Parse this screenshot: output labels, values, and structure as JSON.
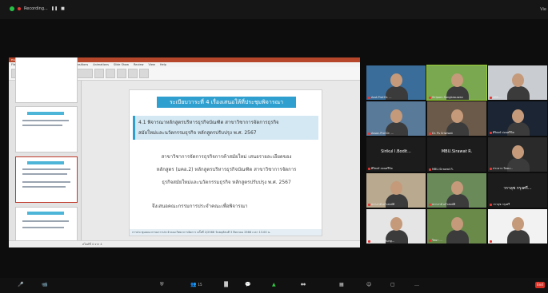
{
  "meeting": {
    "recording_label": "Recording...",
    "pause_glyph": "❚❚",
    "stop_glyph": "■",
    "view_label": "Vie"
  },
  "presentation": {
    "app_title": "PowerPoint",
    "tabs": [
      "File",
      "Home",
      "Insert",
      "Draw",
      "Design",
      "Transitions",
      "Animations",
      "Slide Show",
      "Review",
      "View",
      "Help"
    ],
    "slide": {
      "title": "ระเบียบวาระที่ 4 เรื่องเสนอให้ที่ประชุมพิจารณา",
      "subtitle_line1": "4.1 พิจารณาหลักสูตรบริหารธุรกิจบัณฑิต สาขาวิชาการจัดการธุรกิจ",
      "subtitle_line2": "สมัยใหม่และนวัตกรรมธุรกิจ หลักสูตรปรับปรุง พ.ศ. 2567",
      "body_line1": "สาขาวิชาการจัดการธุรกิจการค้าสมัยใหม่ เสนอรายละเอียดของ",
      "body_line2": "หลักสูตร (มคอ.2) หลักสูตรบริหารธุรกิจบัณฑิต สาขาวิชาการจัดการ",
      "body_line3": "ธุรกิจสมัยใหม่และนวัตกรรมธุรกิจ หลักสูตรปรับปรุง พ.ศ. 2567",
      "closing": "จึงเสนอคณะกรรมการประจำคณะเพื่อพิจารณา",
      "footer": "การประชุมคณะกรรมการประจำคณะวิทยาการจัดการ ครั้งที่ 2/2566 วันพฤหัสบดี 3 สิงหาคม 2566 เวลา 13.00 น."
    },
    "status_text": "สไลด์ที่ 4 จาก 4"
  },
  "participants": [
    {
      "name": "Asst.Prof.Dr. ...",
      "color": "#3a6d9a"
    },
    {
      "name": "Siriporn Sangkasuwan",
      "color": "#7aa850"
    },
    {
      "name": "ABS-...",
      "color": "#c9ccd1"
    },
    {
      "name": "Assoc.Prof.Dr. ...",
      "color": "#5a7a9a"
    },
    {
      "name": "Dr. Ps Sriwiwat",
      "color": "#6b5a4a"
    },
    {
      "name": "ศิริพงษ์ อ่อนศรีนิล",
      "color": "#1b2533"
    },
    {
      "name": "ศิริพงษ์ อ่อนศรีนิล",
      "big": "Sirikul I.Bodit...",
      "color": "#1c1c1c"
    },
    {
      "name": "MBU.Sirawat R.",
      "big": "MBU.Sirawat R.",
      "color": "#1c1c1c"
    },
    {
      "name": "ประดาจ นิลคง...",
      "color": "#2a2a2a"
    },
    {
      "name": "ปภาภาส์ แก้วสมบัติ",
      "color": "#b9a98e"
    },
    {
      "name": "ปภาภาส์ แก้วสมบัติ",
      "color": "#6a8a5a"
    },
    {
      "name": "วราลุช กรุงศรี",
      "big": "วราลุช กรุงศรี...",
      "color": "#1c1c1c"
    },
    {
      "name": "Kamolrat Rung...",
      "color": "#e5e5e5"
    },
    {
      "name": "วิทยา ...",
      "color": "#6a8a4a"
    },
    {
      "name": "MNB ...",
      "color": "#f2f2f2"
    }
  ],
  "toolbar": {
    "mute": "🎤",
    "video": "📹",
    "security": "⛨",
    "participants": "👥",
    "participants_count": "15",
    "polls": "▐▌",
    "chat": "💬",
    "share": "▲",
    "record": "⏺⏺",
    "apps": "▦",
    "reactions": "☺",
    "whiteboard": "▢",
    "more": "…",
    "end_label": "End"
  }
}
